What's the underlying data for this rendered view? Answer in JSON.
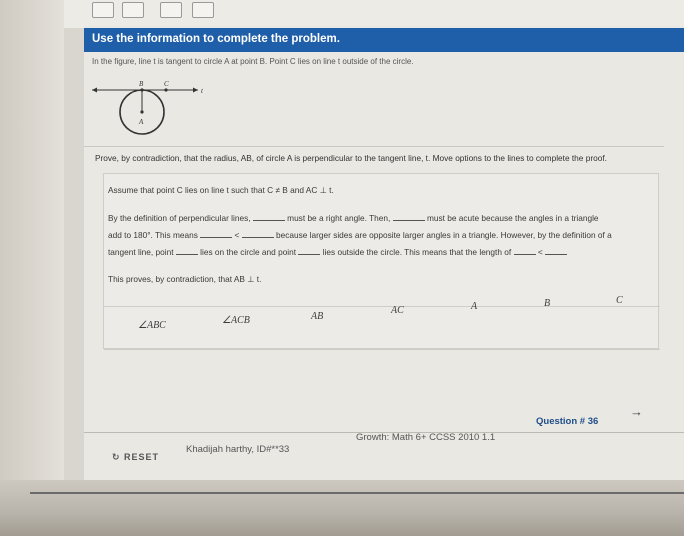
{
  "header": {
    "title": "Use the information to complete the problem."
  },
  "intro": {
    "text": "In the figure, line t is tangent to circle A at point B. Point C lies on line t outside of the circle."
  },
  "figure": {
    "label_b": "B",
    "label_c": "C",
    "label_t": "t",
    "label_a": "A"
  },
  "prompt": {
    "text": "Prove, by contradiction, that the radius, AB, of circle A is perpendicular to the tangent line, t. Move options to the lines to complete the proof."
  },
  "proof": {
    "assume": "Assume that point C lies on line t such that C ≠ B and AC ⊥ t.",
    "line1_a": "By the definition of perpendicular lines,",
    "line1_b": "must be a right angle. Then,",
    "line1_c": "must be acute because the angles in a triangle",
    "line2_a": "add to 180°. This means",
    "line2_lt": "<",
    "line2_b": "because larger sides are opposite larger angles in a triangle. However, by the definition of a",
    "line3_a": "tangent line, point",
    "line3_b": "lies on the circle and point",
    "line3_c": "lies outside the circle. This means that the length of",
    "line3_lt": "<",
    "conclusion": "This proves, by contradiction, that AB ⊥ t."
  },
  "options": {
    "items": [
      "∠ABC",
      "∠ACB",
      "AB",
      "AC",
      "A",
      "B",
      "C"
    ]
  },
  "footer": {
    "reset": "RESET",
    "student": "Khadijah harthy, ID#**33",
    "course": "Growth: Math 6+ CCSS 2010 1.1",
    "question": "Question # 36",
    "next": "→"
  }
}
